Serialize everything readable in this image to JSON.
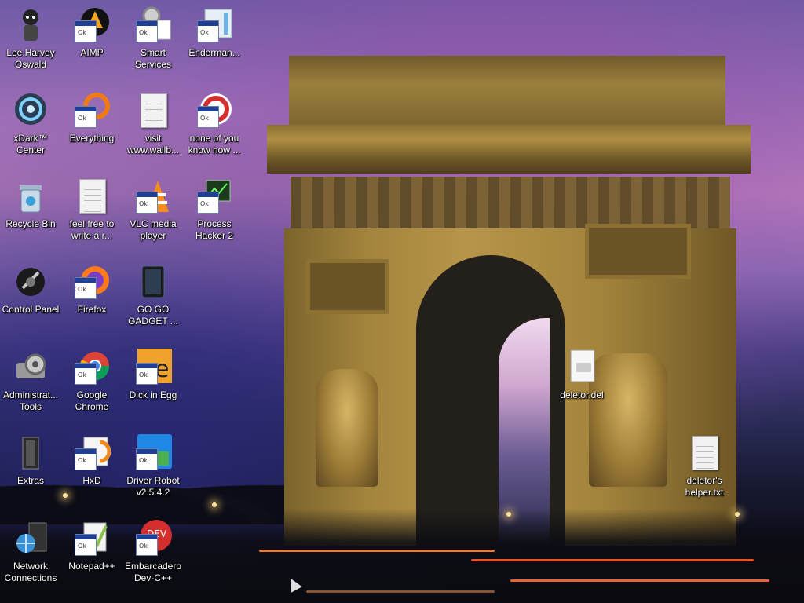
{
  "desktop": {
    "icons": [
      {
        "label": "Lee Harvey Oswald",
        "icon": "person-avatar-icon"
      },
      {
        "label": "AIMP",
        "icon": "aimp-player-icon"
      },
      {
        "label": "Smart Services",
        "icon": "gear-services-icon"
      },
      {
        "label": "Enderman...",
        "icon": "app-window-icon"
      },
      {
        "label": "xDark™ Center",
        "icon": "xdark-center-icon"
      },
      {
        "label": "Everything",
        "icon": "search-everything-icon"
      },
      {
        "label": "visit www.wallb...",
        "icon": "text-document-icon"
      },
      {
        "label": "none of you know how ...",
        "icon": "ring-app-icon"
      },
      {
        "label": "Recycle Bin",
        "icon": "recycle-bin-icon"
      },
      {
        "label": "feel free to write a r...",
        "icon": "text-document-icon"
      },
      {
        "label": "VLC media player",
        "icon": "vlc-cone-icon"
      },
      {
        "label": "Process Hacker 2",
        "icon": "process-hacker-icon"
      },
      {
        "label": "Control Panel",
        "icon": "control-panel-icon"
      },
      {
        "label": "Firefox",
        "icon": "firefox-icon"
      },
      {
        "label": "GO GO GADGET ...",
        "icon": "gadget-device-icon"
      },
      {
        "label": "Administrat... Tools",
        "icon": "admin-tools-gear-icon"
      },
      {
        "label": "Google Chrome",
        "icon": "chrome-icon"
      },
      {
        "label": "Dick in Egg",
        "icon": "dick-in-egg-icon"
      },
      {
        "label": "Extras",
        "icon": "folder-extras-icon"
      },
      {
        "label": "HxD",
        "icon": "hxd-hex-editor-icon"
      },
      {
        "label": "Driver Robot v2.5.4.2",
        "icon": "driver-robot-icon"
      },
      {
        "label": "Network Connections",
        "icon": "network-globe-icon"
      },
      {
        "label": "Notepad++",
        "icon": "notepad-plus-plus-icon"
      },
      {
        "label": "Embarcadero Dev-C++",
        "icon": "dev-cpp-icon"
      },
      {
        "label": "deletor.del",
        "icon": "del-file-icon"
      },
      {
        "label": "deletor's helper.txt",
        "icon": "text-document-icon"
      }
    ]
  },
  "colors": {
    "label_text": "#ffffff",
    "sky_top": "#6e5aa6",
    "sky_mid": "#b67abc",
    "ground": "#0a0a10"
  }
}
